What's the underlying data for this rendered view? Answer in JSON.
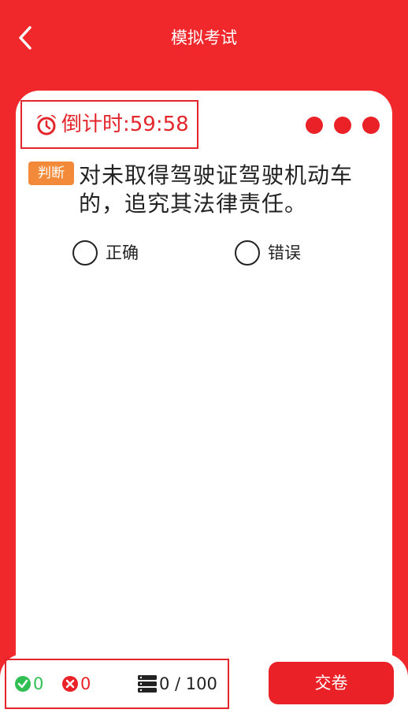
{
  "header": {
    "title": "模拟考试",
    "back_icon": "chevron-left-icon"
  },
  "timer": {
    "label": "倒计时:59:58",
    "icon": "alarm-clock-icon",
    "color": "#e3262b"
  },
  "question": {
    "type_badge": "判断",
    "text": "对未取得驾驶证驾驶机动车的，追究其法律责任。"
  },
  "options": [
    {
      "label": "正确",
      "selected": false
    },
    {
      "label": "错误",
      "selected": false
    }
  ],
  "stats": {
    "correct_count": "0",
    "wrong_count": "0",
    "progress": "0 / 100"
  },
  "submit": {
    "label": "交卷"
  },
  "colors": {
    "brand_red": "#f1282b",
    "badge_orange": "#f28a3a",
    "correct_green": "#2fbf52"
  }
}
